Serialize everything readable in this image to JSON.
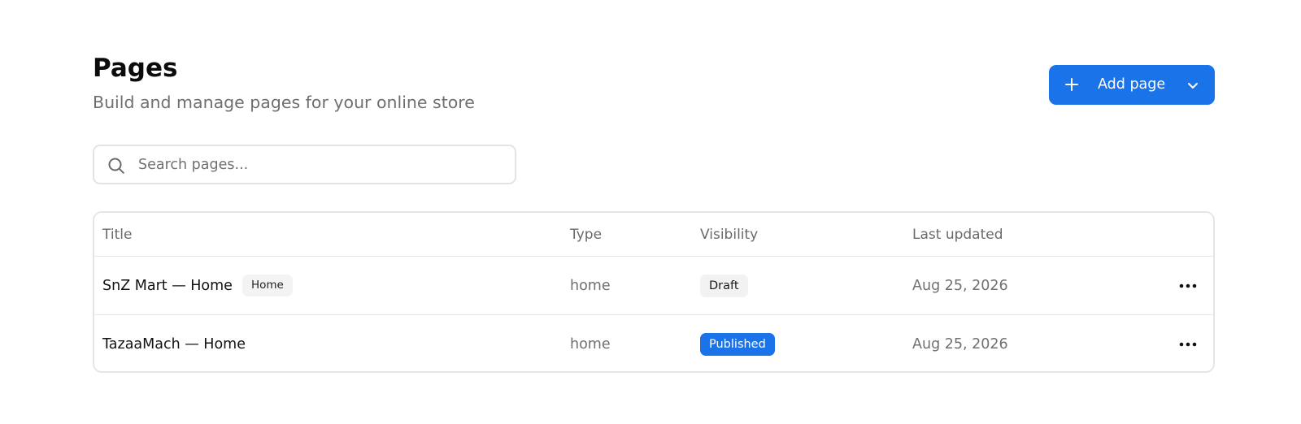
{
  "header": {
    "title": "Pages",
    "subtitle": "Build and manage pages for your online store"
  },
  "add_button": {
    "label": "Add page",
    "icon": "plus-icon",
    "dropdown_icon": "chevron-down-icon",
    "color": "#1a73e8"
  },
  "search": {
    "placeholder": "Search pages...",
    "value": "",
    "icon": "search-icon"
  },
  "table": {
    "columns": [
      "Title",
      "Type",
      "Visibility",
      "Last updated"
    ],
    "rows": [
      {
        "title": "SnZ Mart — Home",
        "tag": "Home",
        "type": "home",
        "visibility": "Draft",
        "updated": "Aug 25, 2026",
        "actions_icon": "more-horizontal-icon"
      },
      {
        "title": "TazaaMach — Home",
        "tag": "",
        "type": "home",
        "visibility": "Published",
        "updated": "Aug 25, 2026",
        "actions_icon": "more-horizontal-icon"
      }
    ]
  },
  "colors": {
    "accent": "#1a73e8",
    "draft_badge": "#f2f2f2",
    "published_badge": "#1a73e8"
  }
}
